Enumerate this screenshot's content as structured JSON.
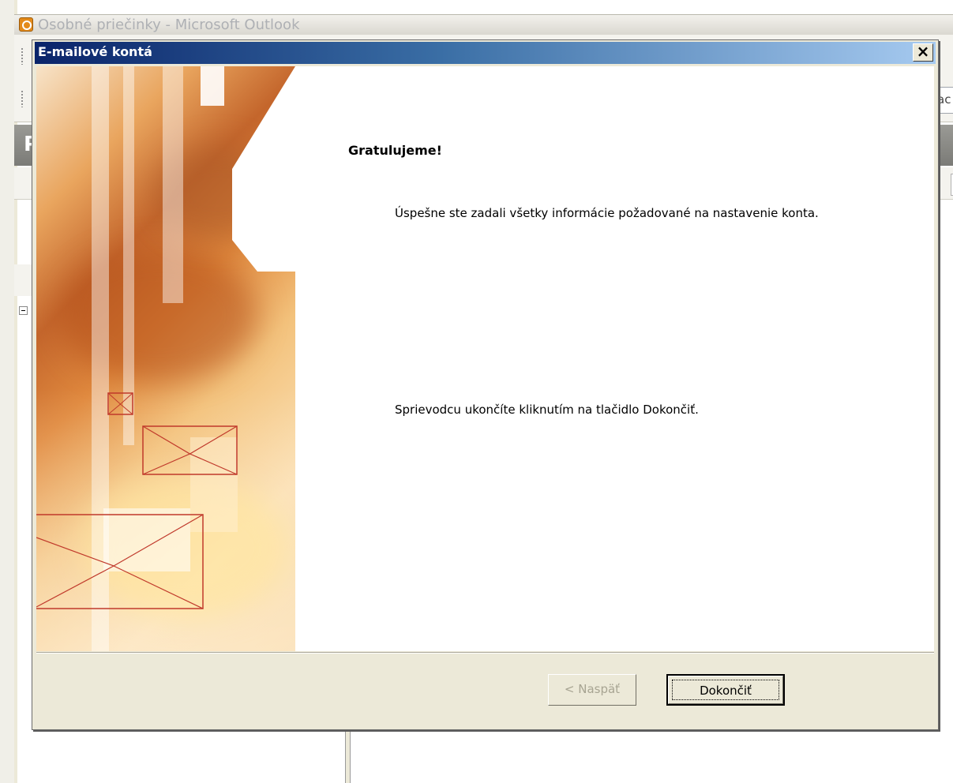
{
  "outlook": {
    "window_title": "Osobné priečinky - Microsoft Outlook",
    "pane_header_letter": "P",
    "search_peek": "ac"
  },
  "dialog": {
    "title": "E-mailové kontá",
    "close_glyph": "×",
    "heading": "Gratulujeme!",
    "message": "Úspešne ste zadali všetky informácie požadované na nastavenie konta.",
    "instruction": "Sprievodcu ukončíte kliknutím na tlačidlo Dokončiť.",
    "buttons": {
      "back_label": "< Naspäť",
      "finish_label": "Dokončiť"
    }
  },
  "colors": {
    "titlebar_start": "#0a246a",
    "titlebar_end": "#a6caf0",
    "dialog_face": "#ece9d8",
    "banner_orange": "#e0893e",
    "envelope_line": "#c0392b"
  },
  "icons": {
    "outlook_app": "outlook-clock-icon",
    "close": "close-icon",
    "envelopes": "envelope-icon"
  }
}
